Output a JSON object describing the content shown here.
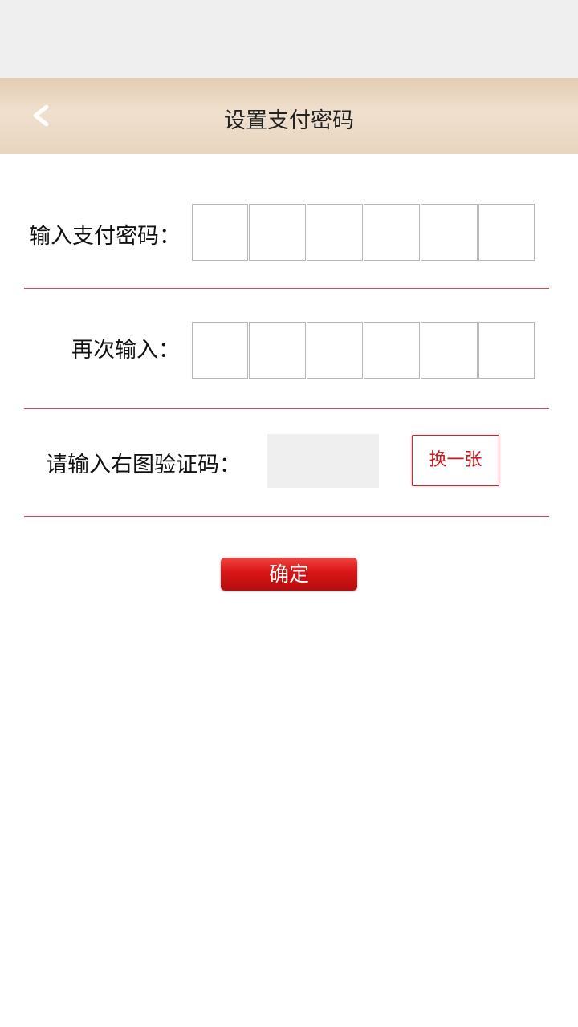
{
  "header": {
    "back_icon": "chevron-left-icon",
    "title": "设置支付密码"
  },
  "form": {
    "password_label": "输入支付密码：",
    "confirm_label": "再次输入：",
    "captcha_label": "请输入右图验证码：",
    "captcha_value": "",
    "refresh_label": "换一张"
  },
  "submit": {
    "label": "确定"
  },
  "colors": {
    "accent": "#d81516",
    "divider": "#e0444f",
    "header_bg": "#e8d5bf"
  }
}
